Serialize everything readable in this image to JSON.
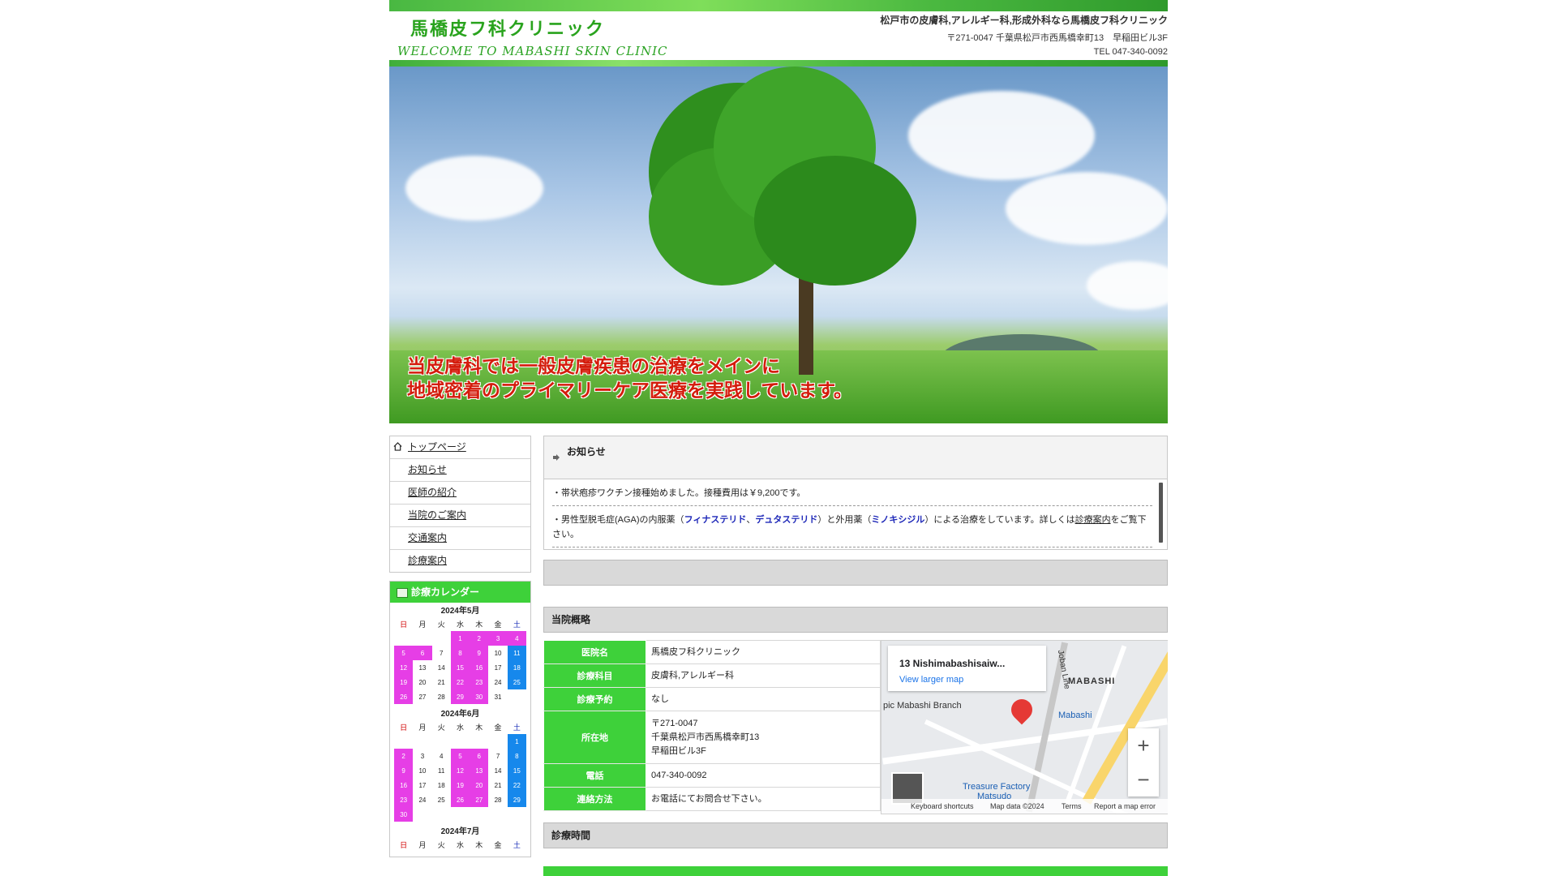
{
  "header": {
    "title": "馬橋皮フ科クリニック",
    "subtitle": "WELCOME TO MABASHI SKIN CLINIC",
    "description": "松戸市の皮膚科,アレルギー科,形成外科なら馬橋皮フ科クリニック",
    "address": "〒271-0047 千葉県松戸市西馬橋幸町13　早稲田ビル3F",
    "tel": "TEL 047-340-0092"
  },
  "hero": {
    "line1": "当皮膚科では一般皮膚疾患の治療をメインに",
    "line2": "地域密着のプライマリーケア医療を実践しています。"
  },
  "nav": {
    "items": [
      {
        "label": "トップページ",
        "icon": "home-icon"
      },
      {
        "label": "お知らせ"
      },
      {
        "label": "医師の紹介"
      },
      {
        "label": "当院のご案内"
      },
      {
        "label": "交通案内"
      },
      {
        "label": "診療案内"
      }
    ]
  },
  "calendar": {
    "title": "診療カレンダー",
    "weekdays": [
      "日",
      "月",
      "火",
      "水",
      "木",
      "金",
      "土"
    ],
    "months": [
      {
        "label": "2024年5月",
        "weeks": [
          [
            {
              "d": ""
            },
            {
              "d": ""
            },
            {
              "d": ""
            },
            {
              "d": "1",
              "c": "m"
            },
            {
              "d": "2",
              "c": "m"
            },
            {
              "d": "3",
              "c": "m"
            },
            {
              "d": "4",
              "c": "m"
            }
          ],
          [
            {
              "d": "5",
              "c": "m"
            },
            {
              "d": "6",
              "c": "m"
            },
            {
              "d": "7"
            },
            {
              "d": "8",
              "c": "m"
            },
            {
              "d": "9",
              "c": "m"
            },
            {
              "d": "10"
            },
            {
              "d": "11",
              "c": "b"
            }
          ],
          [
            {
              "d": "12",
              "c": "m"
            },
            {
              "d": "13"
            },
            {
              "d": "14"
            },
            {
              "d": "15",
              "c": "m"
            },
            {
              "d": "16",
              "c": "m"
            },
            {
              "d": "17"
            },
            {
              "d": "18",
              "c": "b"
            }
          ],
          [
            {
              "d": "19",
              "c": "m"
            },
            {
              "d": "20"
            },
            {
              "d": "21"
            },
            {
              "d": "22",
              "c": "m"
            },
            {
              "d": "23",
              "c": "m"
            },
            {
              "d": "24"
            },
            {
              "d": "25",
              "c": "b"
            }
          ],
          [
            {
              "d": "26",
              "c": "m"
            },
            {
              "d": "27"
            },
            {
              "d": "28"
            },
            {
              "d": "29",
              "c": "m"
            },
            {
              "d": "30",
              "c": "m"
            },
            {
              "d": "31"
            },
            {
              "d": ""
            }
          ]
        ]
      },
      {
        "label": "2024年6月",
        "weeks": [
          [
            {
              "d": ""
            },
            {
              "d": ""
            },
            {
              "d": ""
            },
            {
              "d": ""
            },
            {
              "d": ""
            },
            {
              "d": ""
            },
            {
              "d": "1",
              "c": "b"
            }
          ],
          [
            {
              "d": "2",
              "c": "m"
            },
            {
              "d": "3"
            },
            {
              "d": "4"
            },
            {
              "d": "5",
              "c": "m"
            },
            {
              "d": "6",
              "c": "m"
            },
            {
              "d": "7"
            },
            {
              "d": "8",
              "c": "b"
            }
          ],
          [
            {
              "d": "9",
              "c": "m"
            },
            {
              "d": "10"
            },
            {
              "d": "11"
            },
            {
              "d": "12",
              "c": "m"
            },
            {
              "d": "13",
              "c": "m"
            },
            {
              "d": "14"
            },
            {
              "d": "15",
              "c": "b"
            }
          ],
          [
            {
              "d": "16",
              "c": "m"
            },
            {
              "d": "17"
            },
            {
              "d": "18"
            },
            {
              "d": "19",
              "c": "m"
            },
            {
              "d": "20",
              "c": "m"
            },
            {
              "d": "21"
            },
            {
              "d": "22",
              "c": "b"
            }
          ],
          [
            {
              "d": "23",
              "c": "m"
            },
            {
              "d": "24"
            },
            {
              "d": "25"
            },
            {
              "d": "26",
              "c": "m"
            },
            {
              "d": "27",
              "c": "m"
            },
            {
              "d": "28"
            },
            {
              "d": "29",
              "c": "b"
            }
          ],
          [
            {
              "d": "30",
              "c": "m"
            },
            {
              "d": ""
            },
            {
              "d": ""
            },
            {
              "d": ""
            },
            {
              "d": ""
            },
            {
              "d": ""
            },
            {
              "d": ""
            }
          ]
        ]
      },
      {
        "label": "2024年7月",
        "weeks": []
      }
    ]
  },
  "news": {
    "title": "お知らせ",
    "item1": "・帯状疱疹ワクチン接種始めました。接種費用は￥9,200です。",
    "item2_pre": "・男性型脱毛症(AGA)の内服薬（",
    "item2_drug1": "フィナステリド",
    "item2_sep": "、",
    "item2_drug2": "デュタステリド",
    "item2_mid": "）と外用薬（",
    "item2_drug3": "ミノキシジル",
    "item2_post": "）による治療をしています。詳しくは",
    "item2_link": "診療案内",
    "item2_end": "をご覧下さい。"
  },
  "overview": {
    "title": "当院概略",
    "rows": [
      {
        "th": "医院名",
        "td": "馬橋皮フ科クリニック"
      },
      {
        "th": "診療科目",
        "td": "皮膚科,アレルギー科"
      },
      {
        "th": "診療予約",
        "td": "なし"
      },
      {
        "th": "所在地",
        "td1": "〒271-0047",
        "td2": "千葉県松戸市西馬橋幸町13",
        "td3": "早稲田ビル3F"
      },
      {
        "th": "電話",
        "td": "047-340-0092"
      },
      {
        "th": "連絡方法",
        "td": "お電話にてお問合せ下さい。"
      }
    ]
  },
  "map": {
    "place": "13 Nishimabashisaiw...",
    "link": "View larger map",
    "label_mabashi": "MABASHI",
    "label_branch": "pic Mabashi Branch",
    "label_station": "Mabashi",
    "label_treasure": "Treasure Factory",
    "label_matsudo": "Matsudo",
    "label_joban": "Joban Line",
    "zoom_in": "+",
    "zoom_out": "−",
    "footer_keys": "Keyboard shortcuts",
    "footer_data": "Map data ©2024",
    "footer_terms": "Terms",
    "footer_report": "Report a map error"
  },
  "hours": {
    "title": "診療時間"
  }
}
